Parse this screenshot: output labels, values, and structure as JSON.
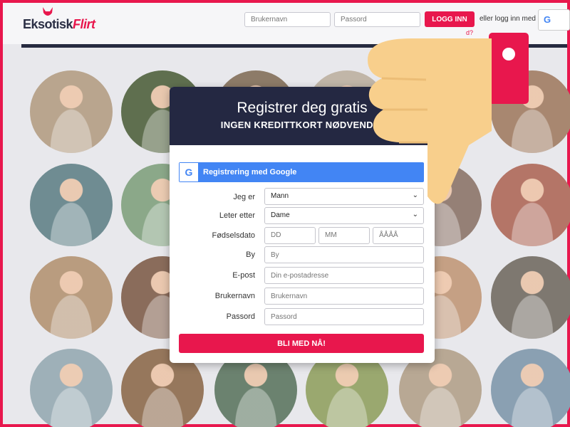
{
  "site": {
    "logo_primary": "Eksotisk",
    "logo_accent": "Flirt",
    "accent_color": "#e8174d",
    "dark_color": "#242842"
  },
  "header": {
    "username_placeholder": "Brukernavn",
    "password_placeholder": "Passord",
    "login_label": "LOGG INN",
    "login_with_label": "eller logg inn med",
    "google_icon": "google-g-icon",
    "forgot_label": "d?"
  },
  "registration": {
    "title": "Registrer deg gratis",
    "subtitle": "INGEN KREDITTKORT NØDVENDIG",
    "google_label": "Registrering med Google",
    "fields": {
      "gender": {
        "label": "Jeg er",
        "value": "Mann"
      },
      "seeking": {
        "label": "Leter etter",
        "value": "Dame"
      },
      "birthdate": {
        "label": "Fødselsdato",
        "day": "DD",
        "month": "MM",
        "year": "ÅÅÅÅ"
      },
      "city": {
        "label": "By",
        "placeholder": "By"
      },
      "email": {
        "label": "E-post",
        "placeholder": "Din e-postadresse"
      },
      "username": {
        "label": "Brukernavn",
        "placeholder": "Brukernavn"
      },
      "password": {
        "label": "Passord",
        "placeholder": "Passord"
      }
    },
    "submit_label": "BLI MED NÅ!"
  },
  "overlay": {
    "icon": "thumbs-down-icon"
  },
  "profile_photos": [
    {
      "bg": "#b9a58e"
    },
    {
      "bg": "#5f6f4f"
    },
    {
      "bg": "#8d7b68"
    },
    {
      "bg": "#c1b6a8"
    },
    {
      "bg": "#aab2b9"
    },
    {
      "bg": "#a88770"
    },
    {
      "bg": "#6f8c92"
    },
    {
      "bg": "#8ba889"
    },
    {
      "bg": "#d5a987"
    },
    {
      "bg": "#d1b3a0"
    },
    {
      "bg": "#958076"
    },
    {
      "bg": "#b47567"
    },
    {
      "bg": "#b99c7f"
    },
    {
      "bg": "#8a6c5b"
    },
    {
      "bg": "#a88b6d"
    },
    {
      "bg": "#b07e5e"
    },
    {
      "bg": "#c5a084"
    },
    {
      "bg": "#7e7870"
    },
    {
      "bg": "#9eb0b8"
    },
    {
      "bg": "#96775c"
    },
    {
      "bg": "#6b826f"
    },
    {
      "bg": "#9aa86f"
    },
    {
      "bg": "#b8a894"
    },
    {
      "bg": "#8aa0b2"
    }
  ]
}
